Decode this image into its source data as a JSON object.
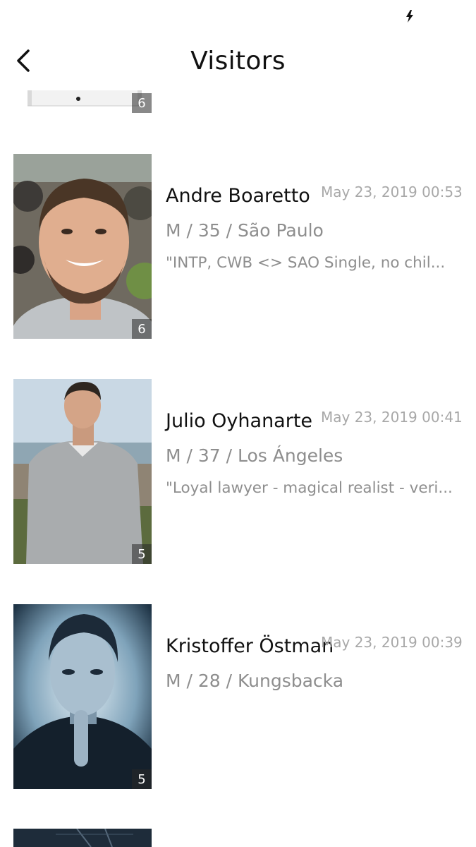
{
  "status_bar": {
    "charging_icon": "bolt-icon"
  },
  "header": {
    "title": "Visitors",
    "back_icon": "chevron-left-icon"
  },
  "visitors": [
    {
      "photo_count": "6"
    },
    {
      "name": "Andre Boaretto",
      "time": "May 23, 2019 00:53",
      "info": "M / 35 / São Paulo",
      "bio": "\"INTP, CWB <> SAO Single, no chil...",
      "photo_count": "6"
    },
    {
      "name": "Julio Oyhanarte",
      "time": "May 23, 2019 00:41",
      "info": "M / 37 / Los Ángeles",
      "bio": "\"Loyal lawyer - magical realist - veri...",
      "photo_count": "5"
    },
    {
      "name": "Kristoffer Östman",
      "time": "May 23, 2019 00:39",
      "info": "M / 28 / Kungsbacka",
      "photo_count": "5"
    }
  ]
}
